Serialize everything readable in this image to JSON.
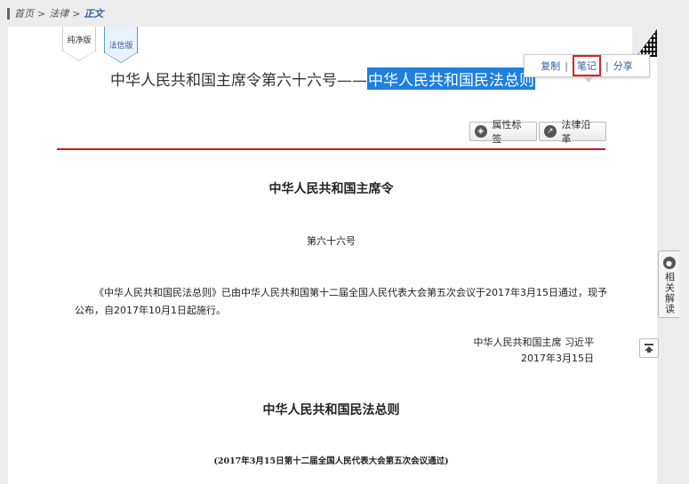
{
  "breadcrumb": {
    "home": "首页",
    "law": "法律",
    "current": "正文",
    "separator": ">"
  },
  "tabs": {
    "pure": "纯净版",
    "faxin": "法信版"
  },
  "title": {
    "prefix": "中华人民共和国主席令第六十六号——",
    "highlighted": "中华人民共和国民法总则"
  },
  "context_menu": {
    "copy": "复制",
    "note": "笔记",
    "share": "分享",
    "separator": "|"
  },
  "toolbar": {
    "attributes": "属性标签",
    "history": "法律沿革"
  },
  "document": {
    "heading": "中华人民共和国主席令",
    "order_number": "第六十六号",
    "body": "《中华人民共和国民法总则》已由中华人民共和国第十二届全国人民代表大会第五次会议于2017年3月15日通过，现予公布，自2017年10月1日起施行。",
    "signer": "中华人民共和国主席 习近平",
    "date": "2017年3月15日",
    "law_title": "中华人民共和国民法总则",
    "passed_note": "(2017年3月15日第十二届全国人民代表大会第五次会议通过)"
  },
  "side_panel": {
    "label": "相关解读"
  },
  "colors": {
    "accent": "#2f5fa6",
    "rule": "#c8171e",
    "highlight": "#1e7fe0",
    "note_border": "#e02020"
  },
  "icons": {
    "attributes": "tag-icon",
    "history": "trend-icon",
    "side": "comment-icon",
    "back_to_top": "back-to-top-icon"
  }
}
